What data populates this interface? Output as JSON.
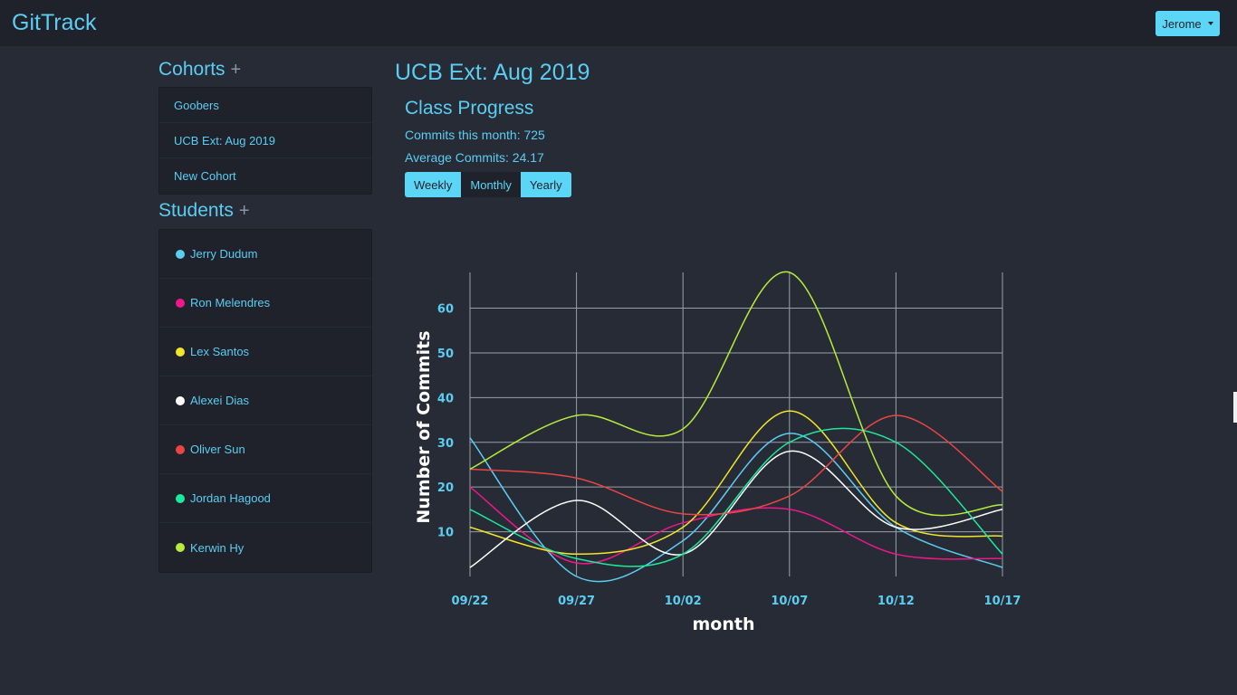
{
  "navbar": {
    "brand": "GitTrack",
    "user_label": "Jerome"
  },
  "sidebar": {
    "cohorts_title": "Cohorts",
    "students_title": "Students",
    "add_symbol": "+",
    "cohorts": [
      {
        "label": "Goobers"
      },
      {
        "label": "UCB Ext: Aug 2019"
      },
      {
        "label": "New Cohort"
      }
    ],
    "students": [
      {
        "label": "Jerry Dudum",
        "color": "#5bcdf2"
      },
      {
        "label": "Ron Melendres",
        "color": "#f0168c"
      },
      {
        "label": "Lex Santos",
        "color": "#f0e62a"
      },
      {
        "label": "Alexei Dias",
        "color": "#ffffff"
      },
      {
        "label": "Oliver Sun",
        "color": "#e94545"
      },
      {
        "label": "Jordan Hagood",
        "color": "#1de89b"
      },
      {
        "label": "Kerwin Hy",
        "color": "#b6ec3c"
      }
    ]
  },
  "main": {
    "title": "UCB Ext: Aug 2019",
    "subtitle": "Class Progress",
    "commits_month": "Commits this month: 725",
    "average_commits": "Average Commits: 24.17",
    "range_buttons": [
      "Weekly",
      "Monthly",
      "Yearly"
    ],
    "active_range": "Monthly"
  },
  "chart_data": {
    "type": "line",
    "x": [
      "09/22",
      "09/27",
      "10/02",
      "10/07",
      "10/12",
      "10/17"
    ],
    "xlabel": "month",
    "ylabel": "Number of Commits",
    "ylim": [
      0,
      68
    ],
    "yticks": [
      10,
      20,
      30,
      40,
      50,
      60
    ],
    "grid": true,
    "series": [
      {
        "color": "#5bcdf2",
        "values": [
          31,
          0,
          8,
          32,
          11,
          2
        ]
      },
      {
        "color": "#f0168c",
        "values": [
          20,
          3,
          12,
          15,
          5,
          4
        ]
      },
      {
        "color": "#f0e62a",
        "values": [
          11,
          5,
          11,
          37,
          12,
          9
        ]
      },
      {
        "color": "#ffffff",
        "values": [
          2,
          17,
          5,
          28,
          11,
          15
        ]
      },
      {
        "color": "#e94545",
        "values": [
          24,
          22,
          14,
          18,
          36,
          19
        ]
      },
      {
        "color": "#1de89b",
        "values": [
          15,
          4,
          5,
          30,
          30,
          5
        ]
      },
      {
        "color": "#b6ec3c",
        "values": [
          24,
          36,
          33,
          68,
          18,
          16
        ]
      }
    ]
  }
}
